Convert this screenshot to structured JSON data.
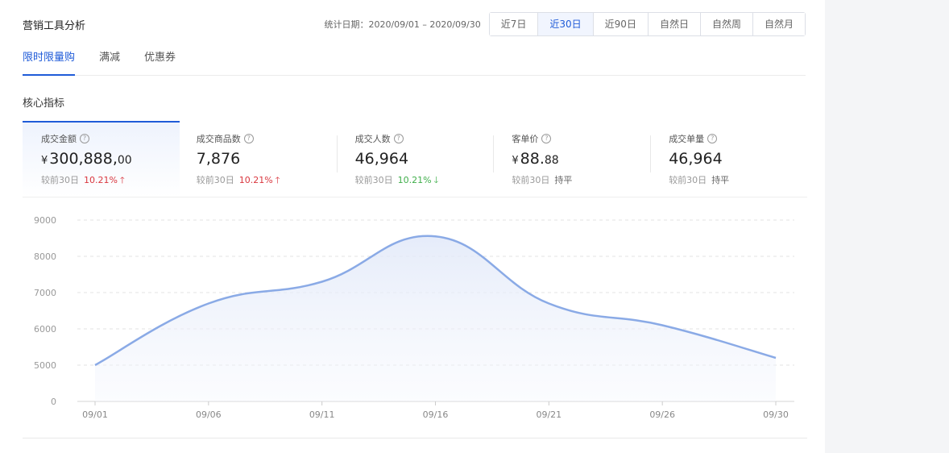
{
  "header": {
    "title": "营销工具分析",
    "date_label": "统计日期：",
    "date_range": "2020/09/01 – 2020/09/30",
    "ranges": [
      "近7日",
      "近30日",
      "近90日",
      "自然日",
      "自然周",
      "自然月"
    ],
    "active_range": "近30日"
  },
  "tabs": [
    {
      "label": "限时限量购",
      "active": true
    },
    {
      "label": "满减",
      "active": false
    },
    {
      "label": "优惠券",
      "active": false
    }
  ],
  "section_title": "核心指标",
  "metrics": [
    {
      "label": "成交金额",
      "currency": "¥",
      "value": "300,888,",
      "value_small": "00",
      "compare_label": "较前30日",
      "change": "10.21%",
      "trend": "up",
      "active": true
    },
    {
      "label": "成交商品数",
      "currency": "",
      "value": "7,876",
      "value_small": "",
      "compare_label": "较前30日",
      "change": "10.21%",
      "trend": "up",
      "active": false
    },
    {
      "label": "成交人数",
      "currency": "",
      "value": "46,964",
      "value_small": "",
      "compare_label": "较前30日",
      "change": "10.21%",
      "trend": "down",
      "active": false
    },
    {
      "label": "客单价",
      "currency": "¥",
      "value": "88.",
      "value_small": "88",
      "compare_label": "较前30日",
      "change": "持平",
      "trend": "flat",
      "active": false
    },
    {
      "label": "成交单量",
      "currency": "",
      "value": "46,964",
      "value_small": "",
      "compare_label": "较前30日",
      "change": "持平",
      "trend": "flat",
      "active": false
    }
  ],
  "icons": {
    "help": "help-circle-icon",
    "up": "arrow-up-icon",
    "down": "arrow-down-icon"
  },
  "colors": {
    "accent": "#1f5bd8",
    "up": "#d9363e",
    "down": "#3fae4a",
    "line": "#8aaae6"
  },
  "chart_data": {
    "type": "area",
    "x": [
      "09/01",
      "09/06",
      "09/11",
      "09/16",
      "09/21",
      "09/26",
      "09/30"
    ],
    "series": [
      {
        "values": [
          5000,
          6700,
          7300,
          8550,
          6700,
          6100,
          5200
        ]
      }
    ],
    "xticks": [
      "09/01",
      "09/06",
      "09/11",
      "09/16",
      "09/21",
      "09/26",
      "09/30"
    ],
    "yticks": [
      0,
      5000,
      6000,
      7000,
      8000,
      9000
    ],
    "grid": true
  }
}
